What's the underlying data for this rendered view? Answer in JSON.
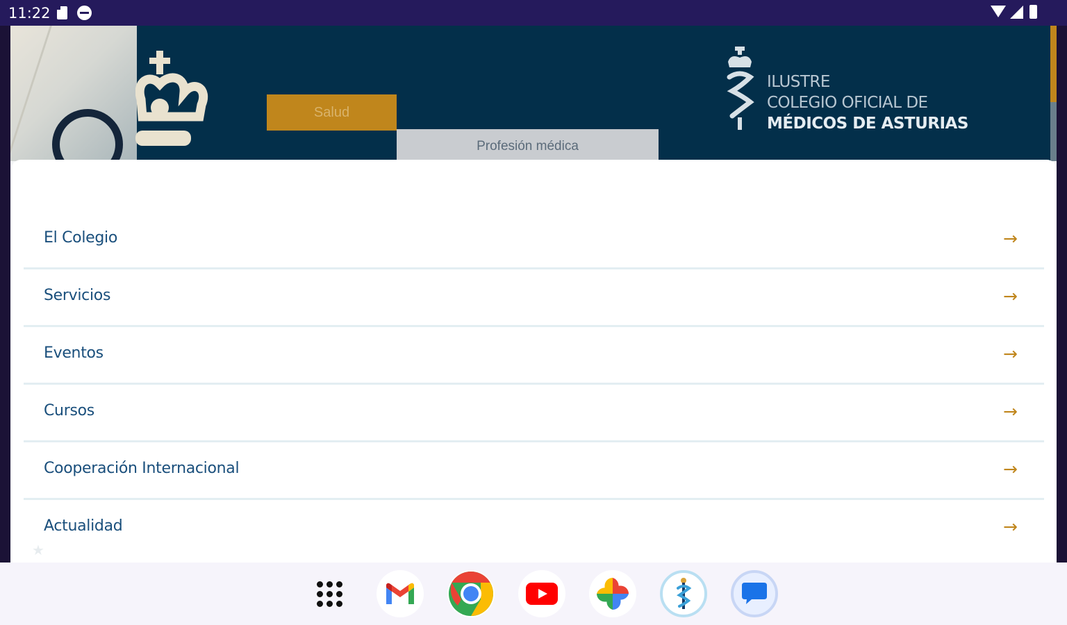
{
  "status_bar": {
    "time": "11:22",
    "icons": [
      "sd-card-icon",
      "do-not-disturb-icon",
      "wifi-icon",
      "signal-icon",
      "battery-icon"
    ]
  },
  "banner": {
    "tabs": [
      {
        "label": "Salud"
      },
      {
        "label": "Profesión médica"
      }
    ],
    "brand": {
      "line1": "ILUSTRE",
      "line2": "COLEGIO OFICIAL DE",
      "line3": "MÉDICOS DE ASTURIAS"
    }
  },
  "menu": {
    "items": [
      {
        "label": "El Colegio"
      },
      {
        "label": "Servicios"
      },
      {
        "label": "Eventos"
      },
      {
        "label": "Cursos"
      },
      {
        "label": "Cooperación Internacional"
      },
      {
        "label": "Actualidad"
      }
    ],
    "arrow_glyph": "→",
    "arrow_color": "#c0861c",
    "label_color": "#1a4f7c"
  },
  "taskbar": {
    "apps": [
      "app-drawer-icon",
      "gmail-icon",
      "chrome-icon",
      "youtube-icon",
      "google-photos-icon",
      "colegio-medicos-icon",
      "messages-icon"
    ]
  },
  "colors": {
    "banner_bg": "#032f4a",
    "accent_gold": "#c0861c",
    "status_bar": "#251a5c"
  }
}
